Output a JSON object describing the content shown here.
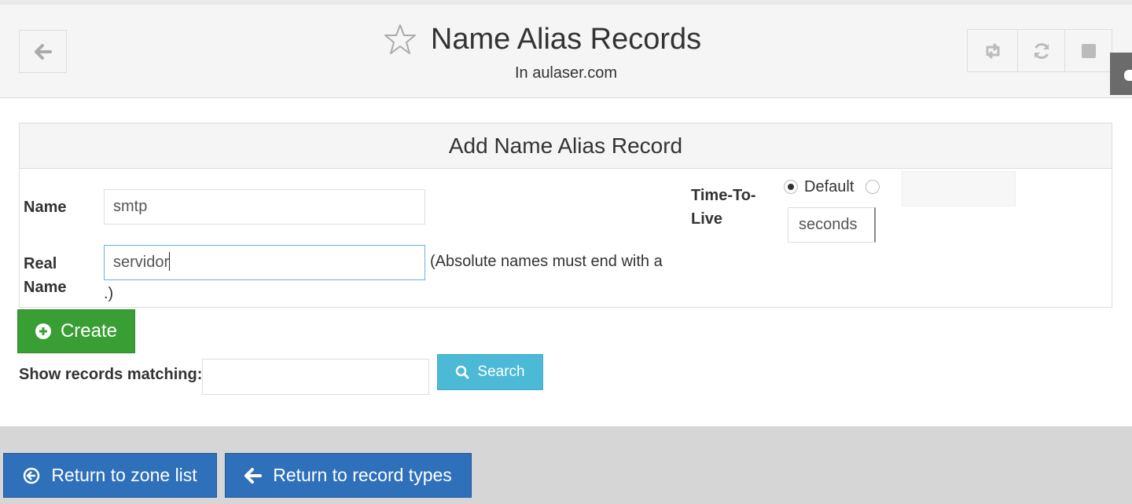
{
  "header": {
    "title": "Name Alias Records",
    "subtitle": "In aulaser.com",
    "icons": [
      "arrow-left-icon",
      "star-icon",
      "retweet-icon",
      "refresh-icon",
      "stop-icon"
    ]
  },
  "form": {
    "heading": "Add Name Alias Record",
    "name_label": "Name",
    "name_value": "smtp",
    "realname_label_1": "Real",
    "realname_label_2": "Name",
    "realname_value": "servidor",
    "realname_hint_1": "(Absolute names must end with a",
    "realname_hint_2": ".)",
    "ttl_label_1": "Time-To-",
    "ttl_label_2": "Live",
    "ttl_default_label": "Default",
    "ttl_value": "",
    "ttl_units": "seconds"
  },
  "buttons": {
    "create": "Create",
    "search": "Search",
    "return_zone": "Return to zone list",
    "return_types": "Return to record types"
  },
  "search": {
    "label": "Show records matching:",
    "value": ""
  },
  "colors": {
    "create": "#399e33",
    "search": "#4cb9d6",
    "nav": "#2e70ba"
  }
}
